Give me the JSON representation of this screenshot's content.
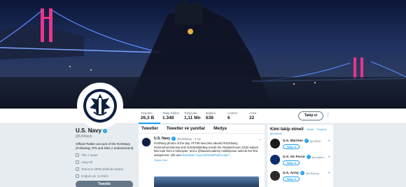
{
  "profile": {
    "name": "U.S. Navy",
    "handle": "@USNavy",
    "bio": "Official Twitter account of the #USNavy. (Following, RTs and links ≠ endorsement)",
    "location": "The 7 seas!",
    "website": "navy.mil",
    "joined": "Temmuz 2009 tarihinde katıldı",
    "born": "Doğum yılı 13 Ekim",
    "tweet_button": "Tweetle"
  },
  "stats": [
    {
      "label": "Tweetler",
      "value": "26,3 B"
    },
    {
      "label": "Takip Edilen",
      "value": "1.348"
    },
    {
      "label": "Takipçiler",
      "value": "1,11 Mn"
    },
    {
      "label": "Beğeni",
      "value": "638"
    },
    {
      "label": "Listeler",
      "value": "6"
    },
    {
      "label": "Anlar",
      "value": "22"
    }
  ],
  "actions": {
    "follow": "Takip et",
    "more": "⋮"
  },
  "timeline": {
    "tabs": [
      "Tweetler",
      "Tweetler ve yanıtlar",
      "Medya"
    ],
    "tweet": {
      "name": "U.S. Navy",
      "handle": "@USNavy · 6 sa",
      "text": "#USNavy photos of the day: #FT06 launches aboard #USSNavy; #USSJohnCStennis and #USSMobileBay transit the #IndianOcean; EOD Sailors fast rope from a helicopter; and a @NavalAcademy midshipman selects her first assignment.",
      "link_text": "info and",
      "link_text2": "download: navy.mil/viewPhotos.asp?...",
      "sub": "Tweet Ģeri"
    }
  },
  "who_to_follow": {
    "title": "Kimi takip etmeli",
    "refresh": "· Yenile · Tümünü",
    "view_all": "görüntüle",
    "suggestions": [
      {
        "name": "U.S. Marines",
        "handle": "@USMC",
        "button": "Takip et",
        "color": "#1a1a1a"
      },
      {
        "name": "U.S. Air Force",
        "handle": "@usairfor...",
        "button": "Takip et",
        "color": "#0d2c6b"
      },
      {
        "name": "U.S. Army",
        "handle": "@USArmy",
        "button": "Takip et",
        "color": "#2b2b2b"
      }
    ]
  }
}
